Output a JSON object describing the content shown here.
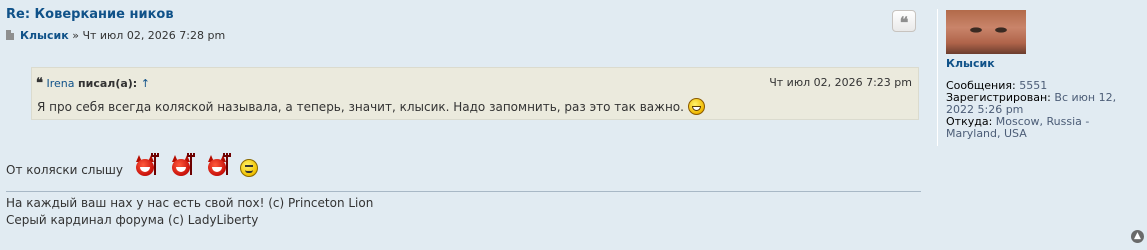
{
  "post": {
    "title": "Re: Коверкание ников",
    "author": "Клысик",
    "separator": "»",
    "datetime": "Чт июл 02, 2026 7:28 pm",
    "quote_button_glyph": "❝"
  },
  "quote": {
    "icon": "quote-icon",
    "user": "Irena",
    "wrote": "писал(а):",
    "arrow": "↑",
    "date": "Чт июл 02, 2026 7:23 pm",
    "text": "Я про себя всегда коляской называла, а теперь, значит, клысик. Надо запомнить, раз это так важно."
  },
  "body": {
    "text": "От коляски слышу"
  },
  "signature": {
    "line1": "На каждый ваш нах у нас есть свой пох! (с) Princeton Lion",
    "line2": "Серый кардинал форума (с) LadyLiberty"
  },
  "profile": {
    "name": "Клысик",
    "posts_label": "Сообщения:",
    "posts_value": "5551",
    "registered_label": "Зарегистрирован:",
    "registered_value": "Вс июн 12, 2022 5:26 pm",
    "location_label": "Откуда:",
    "location_value": "Moscow, Russia - Maryland, USA"
  },
  "colors": {
    "background": "#e1ebf2",
    "link": "#105289",
    "quote_bg": "#ebeadd"
  },
  "icons": {
    "back_to_top": "back-to-top-icon"
  }
}
